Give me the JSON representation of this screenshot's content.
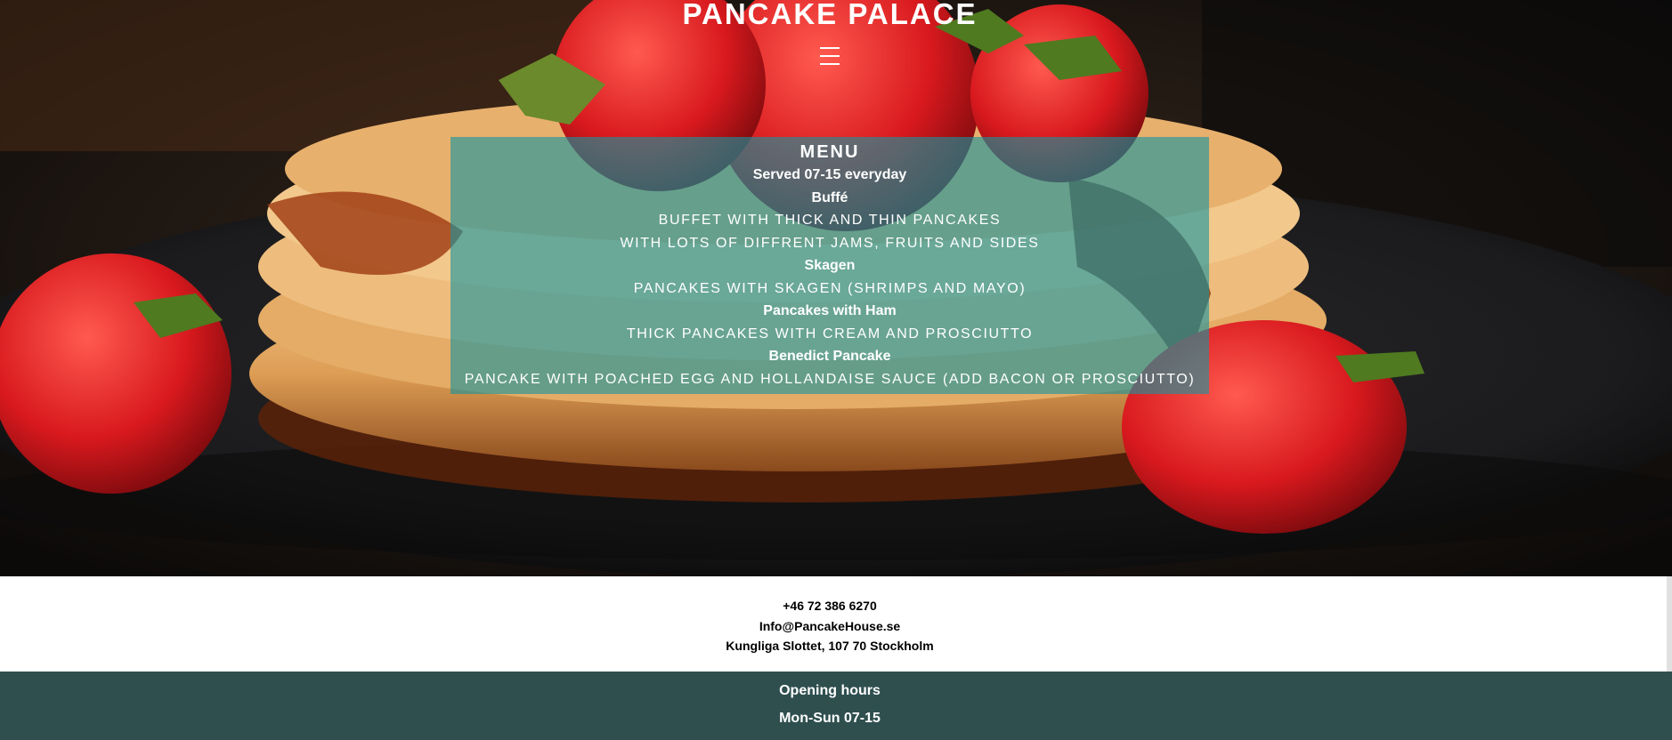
{
  "header": {
    "title": "PANCAKE PALACE",
    "menu_icon": "hamburger-menu-icon"
  },
  "hero": {
    "background": "pancake-stack-with-strawberries-photo"
  },
  "menu": {
    "heading": "MENU",
    "served": "Served 07-15 everyday",
    "items": [
      {
        "name": "Buffé",
        "description": "Buffet with thick and thin pancakes",
        "description2": "with lots of diffrent jams, fruits and sides"
      },
      {
        "name": "Skagen",
        "description": "Pancakes with skagen (shrimps and mayo)"
      },
      {
        "name": "Pancakes with Ham",
        "description": "Thick pancakes with cream and prosciutto"
      },
      {
        "name": "Benedict Pancake",
        "description": "Pancake with poached egg and hollandaise sauce (add bacon or prosciutto)"
      }
    ]
  },
  "contact": {
    "phone": "+46 72 386 6270",
    "email": "Info@PancakeHouse.se",
    "address": "Kungliga Slottet, 107 70 Stockholm"
  },
  "footer": {
    "title": "Opening hours",
    "hours": "Mon-Sun 07-15"
  },
  "colors": {
    "menu_overlay": "#17949e",
    "footer_bg": "#2f4f4f",
    "text_light": "#ffffff"
  }
}
